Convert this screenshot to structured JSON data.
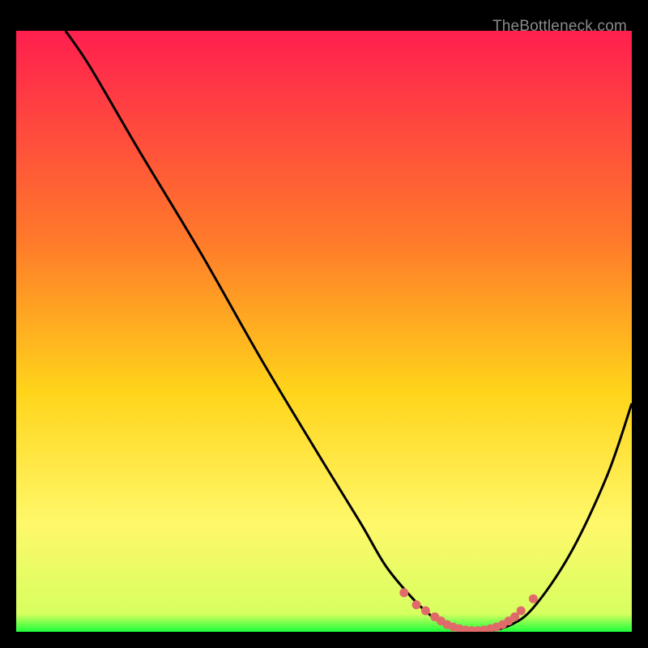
{
  "watermark": "TheBottleneck.com",
  "chart_data": {
    "type": "line",
    "title": "",
    "xlabel": "",
    "ylabel": "",
    "xlim": [
      0,
      100
    ],
    "ylim": [
      0,
      100
    ],
    "grid": false,
    "legend": false,
    "gradient_stops": [
      {
        "offset": 0,
        "color": "#ff1f4f"
      },
      {
        "offset": 0.35,
        "color": "#ff7a2a"
      },
      {
        "offset": 0.6,
        "color": "#ffd41a"
      },
      {
        "offset": 0.82,
        "color": "#fff86a"
      },
      {
        "offset": 0.97,
        "color": "#d7ff60"
      },
      {
        "offset": 1.0,
        "color": "#1cff3a"
      }
    ],
    "series": [
      {
        "name": "curve",
        "stroke": "#000000",
        "x": [
          8,
          12,
          20,
          30,
          40,
          50,
          56,
          60,
          64,
          67,
          70,
          73,
          76,
          80,
          84,
          90,
          96,
          100
        ],
        "values": [
          100,
          94,
          80,
          63,
          45,
          28,
          18,
          11,
          6,
          3,
          1,
          0,
          0,
          1,
          4,
          13,
          26,
          38
        ]
      }
    ],
    "markers": {
      "name": "valley-dots",
      "color": "#e06a6a",
      "x": [
        63,
        65,
        66.5,
        68,
        69,
        70,
        71,
        72,
        73,
        74,
        75,
        76,
        77,
        78,
        79,
        80,
        81,
        82,
        84
      ],
      "values": [
        6.5,
        4.5,
        3.5,
        2.5,
        1.8,
        1.2,
        0.8,
        0.5,
        0.3,
        0.2,
        0.2,
        0.3,
        0.5,
        0.8,
        1.2,
        1.8,
        2.5,
        3.5,
        5.5
      ]
    }
  }
}
